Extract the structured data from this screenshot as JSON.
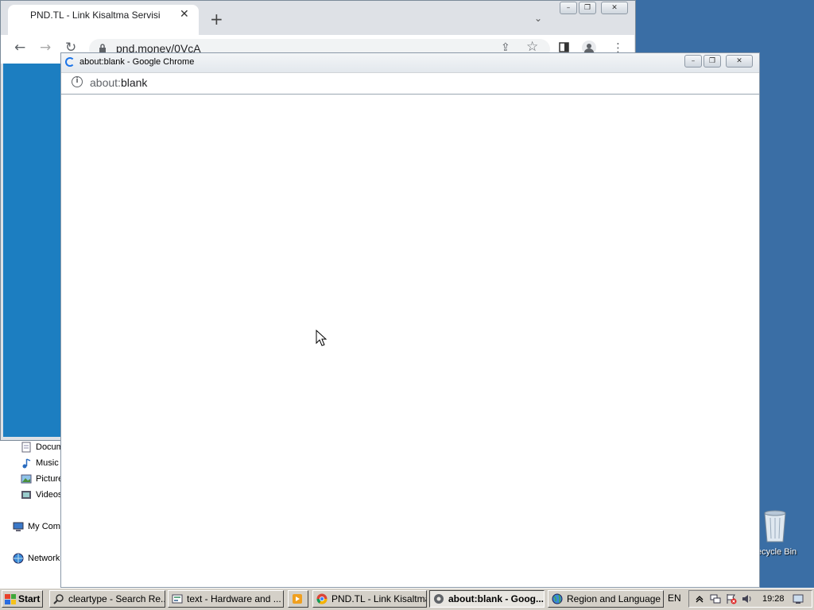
{
  "background_window": {
    "tab_title": "PND.TL - Link Kisaltma Servisi",
    "url": "pnd.money/0VcA"
  },
  "popup_window": {
    "title": "about:blank - Google Chrome",
    "url_scheme": "about:",
    "url_path": "blank"
  },
  "explorer_nav": {
    "items": [
      {
        "label": "Docum",
        "icon": "document-icon"
      },
      {
        "label": "Music",
        "icon": "music-icon"
      },
      {
        "label": "Picture",
        "icon": "pictures-icon"
      },
      {
        "label": "Videos",
        "icon": "videos-icon"
      },
      {
        "label": "My Comp",
        "icon": "computer-icon"
      },
      {
        "label": "Network",
        "icon": "network-icon"
      }
    ]
  },
  "desktop": {
    "recycle_bin_label": "ecycle Bin"
  },
  "taskbar": {
    "start_label": "Start",
    "buttons": [
      {
        "label": "cleartype - Search Re...",
        "icon": "search-icon"
      },
      {
        "label": "text - Hardware and ...",
        "icon": "control-panel-icon"
      },
      {
        "label": "",
        "icon": "media-player-icon"
      },
      {
        "label": "PND.TL - Link Kisaltma...",
        "icon": "chrome-icon"
      },
      {
        "label": "about:blank - Goog...",
        "icon": "chrome-icon",
        "active": true
      },
      {
        "label": "Region and Language",
        "icon": "globe-icon"
      }
    ],
    "language": "EN",
    "clock": "19:28"
  }
}
